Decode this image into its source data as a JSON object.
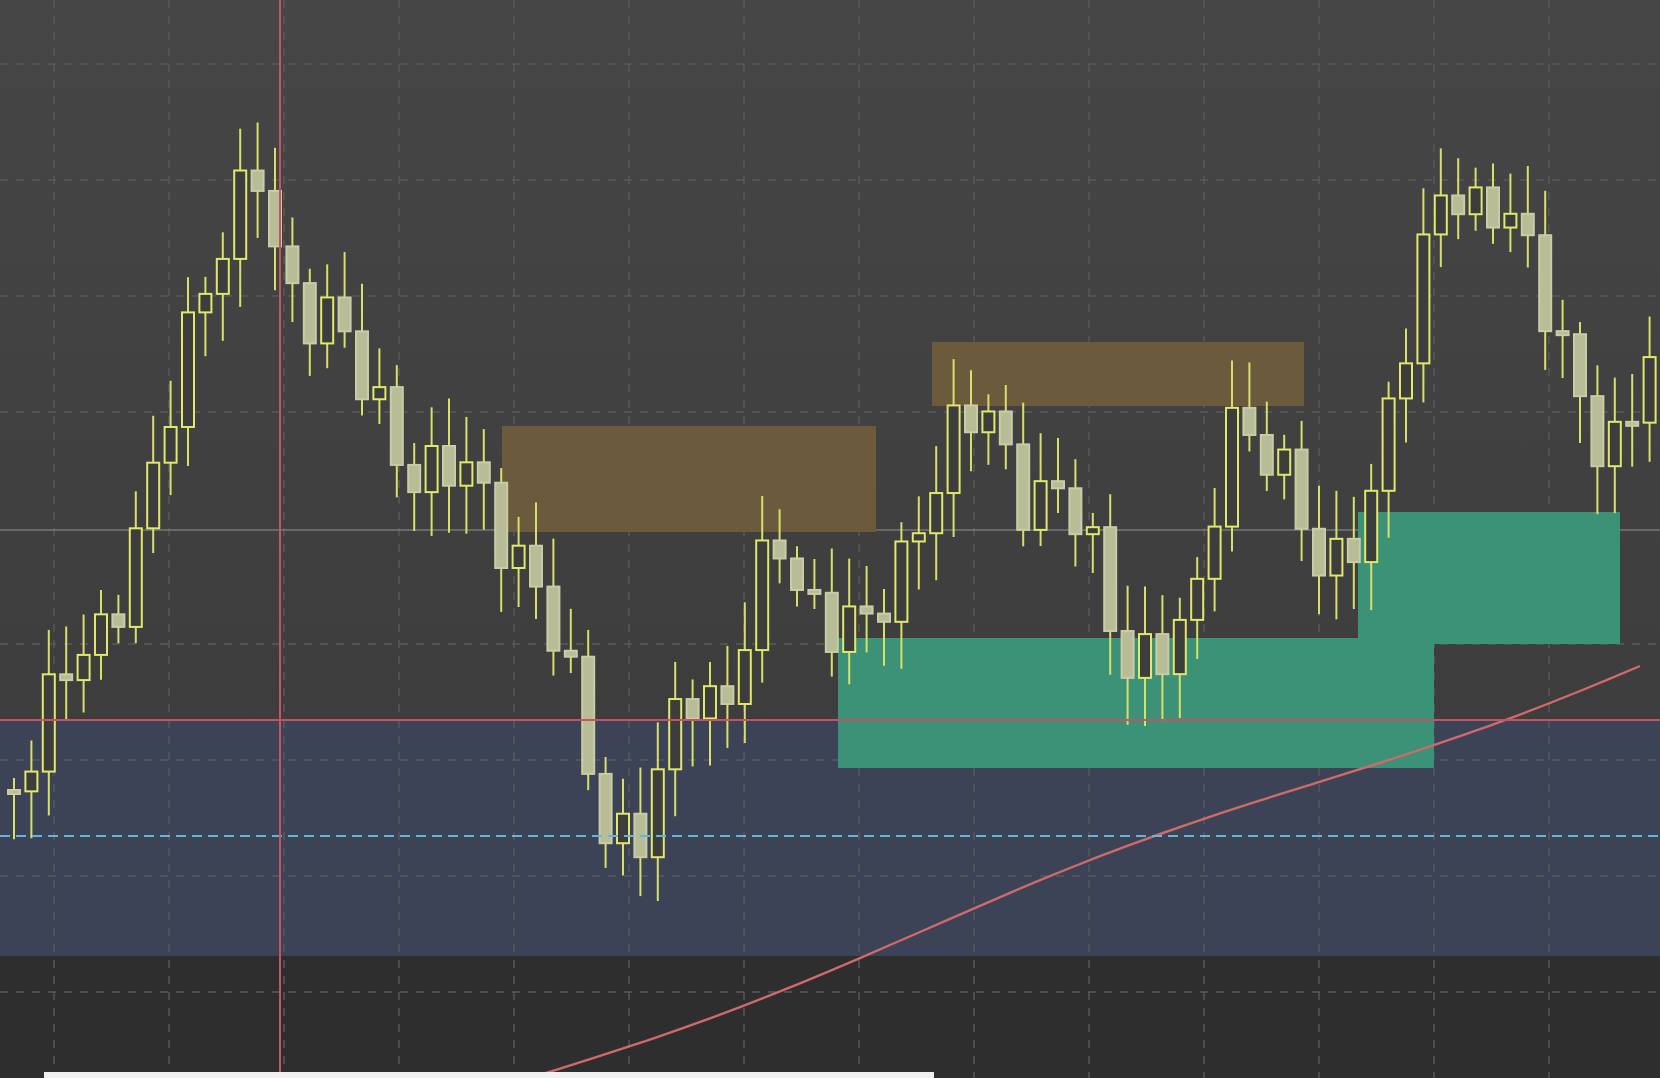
{
  "zones": [
    {
      "color": "#6b5a3b"
    },
    {
      "color": "#6b5a3b"
    },
    {
      "color": "#3b9277"
    },
    {
      "color": "#3b9277"
    }
  ]
}
